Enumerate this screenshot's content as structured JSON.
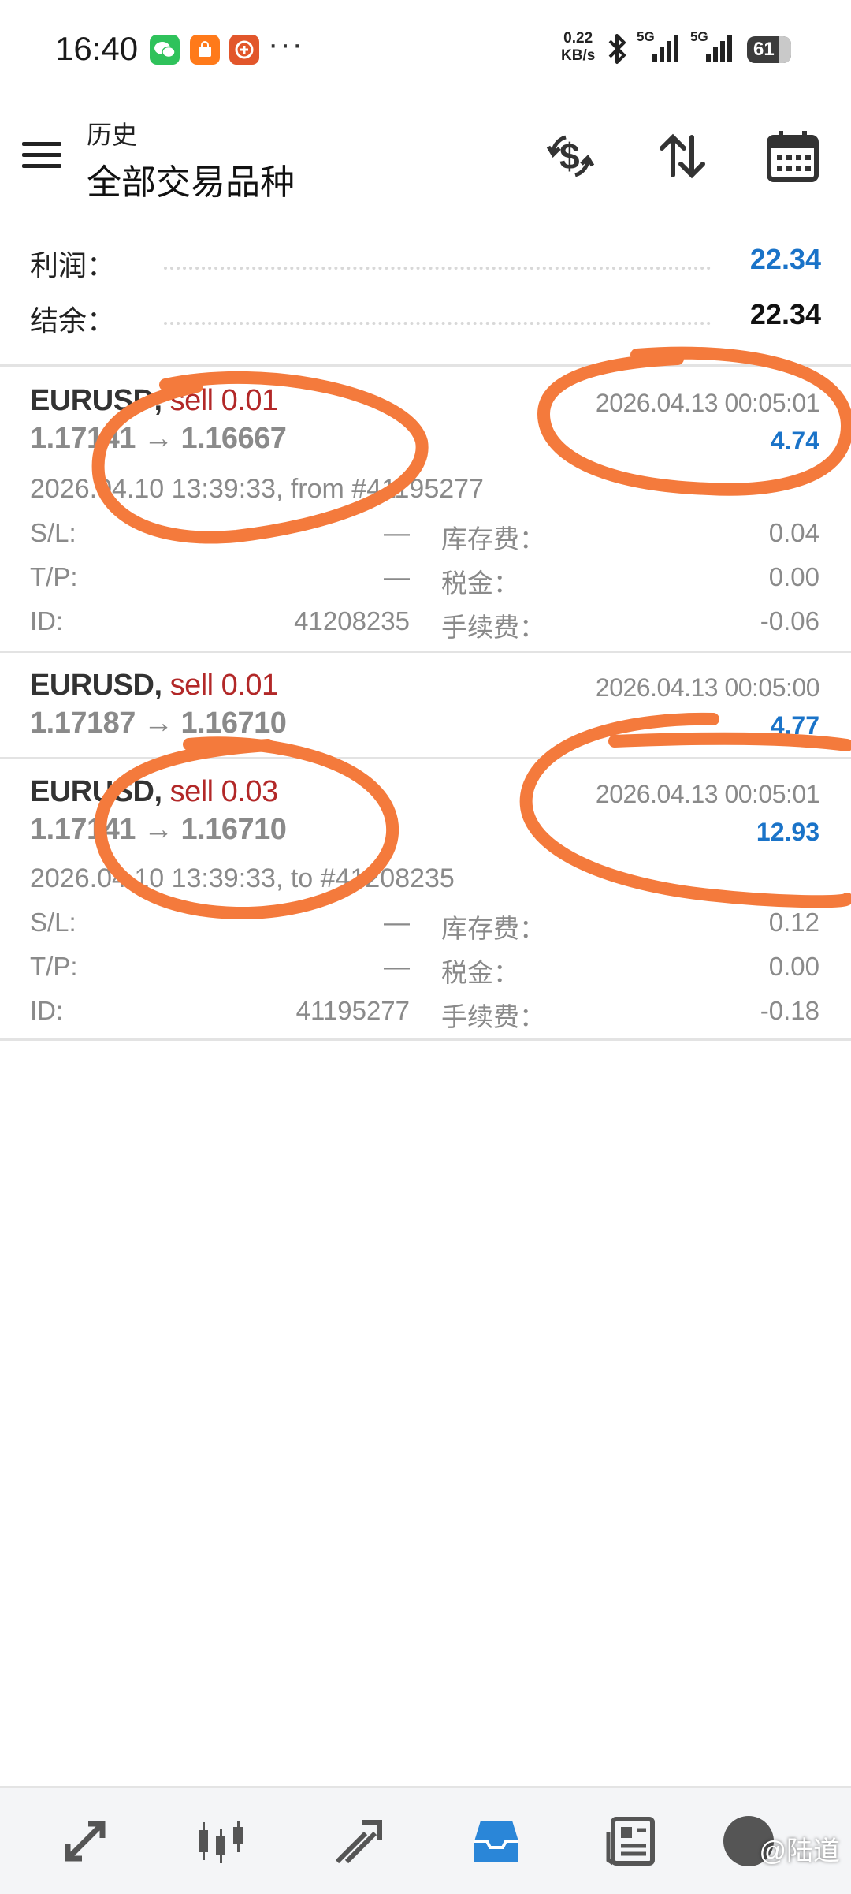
{
  "status_bar": {
    "time": "16:40",
    "network_speed_value": "0.22",
    "network_speed_unit": "KB/s",
    "sim1": "5G",
    "sim2": "5G",
    "battery": "61",
    "more": "···",
    "icons": [
      "wechat-icon",
      "shopping-icon",
      "remote-icon",
      "bluetooth-icon",
      "signal-icon",
      "battery-icon"
    ]
  },
  "header": {
    "subtitle": "历史",
    "title": "全部交易品种",
    "actions": [
      "currency-exchange-icon",
      "sort-icon",
      "calendar-icon"
    ]
  },
  "summary": {
    "profit_label": "利润：",
    "profit_value": "22.34",
    "balance_label": "结余：",
    "balance_value": "22.34"
  },
  "labels": {
    "sl": "S/L:",
    "tp": "T/P:",
    "id": "ID:",
    "swap": "库存费：",
    "tax": "税金：",
    "commission": "手续费："
  },
  "deals": [
    {
      "symbol": "EURUSD,",
      "type": "sell 0.01",
      "price_open": "1.17141",
      "arrow": "→",
      "price_close": "1.16667",
      "close_time": "2026.04.13 00:05:01",
      "profit": "4.74",
      "open_info": "2026.04.10 13:39:33, from #41195277",
      "sl": "—",
      "tp": "—",
      "id": "41208235",
      "swap": "0.04",
      "tax": "0.00",
      "commission": "-0.06"
    },
    {
      "symbol": "EURUSD,",
      "type": "sell 0.01",
      "price_open": "1.17187",
      "arrow": "→",
      "price_close": "1.16710",
      "close_time": "2026.04.13 00:05:00",
      "profit": "4.77"
    },
    {
      "symbol": "EURUSD,",
      "type": "sell 0.03",
      "price_open": "1.17141",
      "arrow": "→",
      "price_close": "1.16710",
      "close_time": "2026.04.13 00:05:01",
      "profit": "12.93",
      "open_info": "2026.04.10 13:39:33, to #41208235",
      "sl": "—",
      "tp": "—",
      "id": "41195277",
      "swap": "0.12",
      "tax": "0.00",
      "commission": "-0.18"
    }
  ],
  "bottom_nav": {
    "items": [
      "quotes-icon",
      "chart-icon",
      "trade-icon",
      "history-icon",
      "news-icon",
      "settings-icon"
    ],
    "active": "history-icon"
  },
  "watermark": "@陆道",
  "colors": {
    "profit_blue": "#1a73c8",
    "sell_red": "#b22828",
    "annotation": "#f47a3c",
    "nav_active": "#2a86d8"
  }
}
